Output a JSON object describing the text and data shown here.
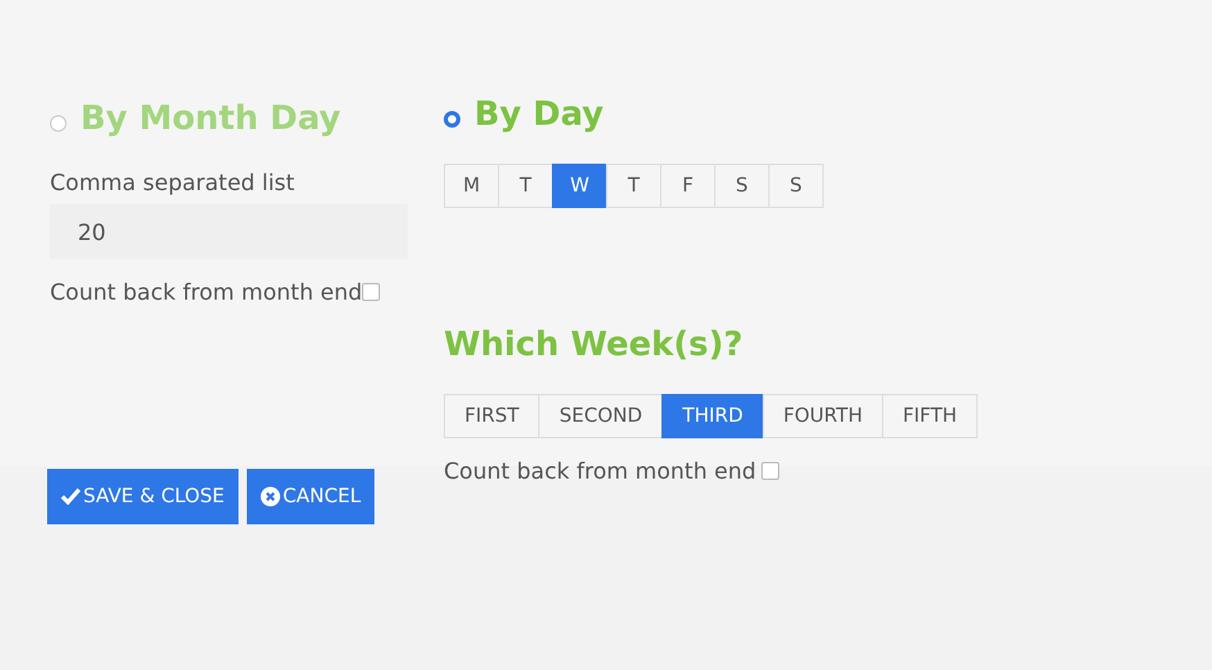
{
  "by_month_day": {
    "label": "By Month Day",
    "selected": false,
    "list_label": "Comma separated list",
    "list_value": "20",
    "count_back": {
      "label": "Count back from month end",
      "checked": false
    }
  },
  "by_day": {
    "label": "By Day",
    "selected": true,
    "days": [
      {
        "label": "M",
        "selected": false
      },
      {
        "label": "T",
        "selected": false
      },
      {
        "label": "W",
        "selected": true
      },
      {
        "label": "T",
        "selected": false
      },
      {
        "label": "F",
        "selected": false
      },
      {
        "label": "S",
        "selected": false
      },
      {
        "label": "S",
        "selected": false
      }
    ],
    "weeks_title": "Which Week(s)?",
    "weeks": [
      {
        "label": "FIRST",
        "selected": false
      },
      {
        "label": "SECOND",
        "selected": false
      },
      {
        "label": "THIRD",
        "selected": true
      },
      {
        "label": "FOURTH",
        "selected": false
      },
      {
        "label": "FIFTH",
        "selected": false
      }
    ],
    "count_back": {
      "label": "Count back from month end",
      "checked": false
    }
  },
  "buttons": [
    {
      "kind": "save",
      "label": "SAVE & CLOSE"
    },
    {
      "kind": "cancel",
      "label": "CANCEL"
    }
  ]
}
